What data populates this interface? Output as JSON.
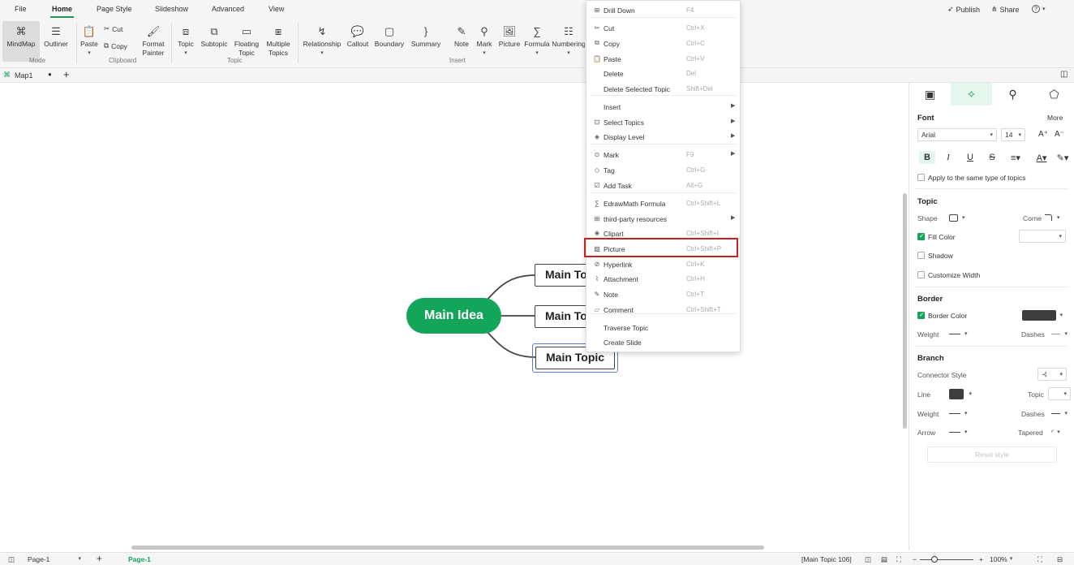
{
  "menubar": {
    "tabs": [
      "File",
      "Home",
      "Page Style",
      "Slideshow",
      "Advanced",
      "View"
    ],
    "active": "Home",
    "publish": "Publish",
    "share": "Share",
    "help": "?"
  },
  "ribbon": {
    "mode": {
      "mindmap": "MindMap",
      "outliner": "Outliner",
      "label": "Mode"
    },
    "clipboard": {
      "paste": "Paste",
      "cut": "Cut",
      "copy": "Copy",
      "format_painter_1": "Format",
      "format_painter_2": "Painter",
      "label": "Clipboard"
    },
    "topic": {
      "topic": "Topic",
      "subtopic": "Subtopic",
      "floating_1": "Floating",
      "floating_2": "Topic",
      "multiple_1": "Multiple",
      "multiple_2": "Topics",
      "label": "Topic"
    },
    "insert": {
      "relationship": "Relationship",
      "callout": "Callout",
      "boundary": "Boundary",
      "summary": "Summary",
      "note": "Note",
      "mark": "Mark",
      "picture": "Picture",
      "formula": "Formula",
      "numbering": "Numbering",
      "label": "Insert"
    }
  },
  "doctabs": {
    "file": "Map1"
  },
  "canvas": {
    "main_idea": "Main Idea",
    "topics": [
      "Main Topic",
      "Main Topic",
      "Main Topic"
    ]
  },
  "context_menu": {
    "items": [
      {
        "label": "Drill Down",
        "shortcut": "F4",
        "icon": "drill-down-icon"
      },
      {
        "label": "Cut",
        "shortcut": "Ctrl+X",
        "icon": "cut-icon"
      },
      {
        "label": "Copy",
        "shortcut": "Ctrl+C",
        "icon": "copy-icon"
      },
      {
        "label": "Paste",
        "shortcut": "Ctrl+V",
        "icon": "paste-icon"
      },
      {
        "label": "Delete",
        "shortcut": "Del"
      },
      {
        "label": "Delete Selected Topic",
        "shortcut": "Shift+Del"
      },
      {
        "label": "Insert",
        "shortcut": ""
      },
      {
        "label": "Select Topics",
        "shortcut": "",
        "icon": "select-icon"
      },
      {
        "label": "Display Level",
        "shortcut": "",
        "icon": "layers-icon"
      },
      {
        "label": "Mark",
        "shortcut": "F9",
        "icon": "mark-icon"
      },
      {
        "label": "Tag",
        "shortcut": "Ctrl+G",
        "icon": "tag-icon"
      },
      {
        "label": "Add Task",
        "shortcut": "Alt+G",
        "icon": "task-icon"
      },
      {
        "label": "EdrawMath Formula",
        "shortcut": "Ctrl+Shift+L",
        "icon": "formula-icon"
      },
      {
        "label": "third-party resources",
        "shortcut": "",
        "icon": "grid-icon"
      },
      {
        "label": "Clipart",
        "shortcut": "Ctrl+Shift+I",
        "icon": "clipart-icon"
      },
      {
        "label": "Picture",
        "shortcut": "Ctrl+Shift+P",
        "icon": "picture-icon"
      },
      {
        "label": "Hyperlink",
        "shortcut": "Ctrl+K",
        "icon": "link-icon"
      },
      {
        "label": "Attachment",
        "shortcut": "Ctrl+H",
        "icon": "attachment-icon"
      },
      {
        "label": "Note",
        "shortcut": "Ctrl+T",
        "icon": "note-icon"
      },
      {
        "label": "Comment",
        "shortcut": "Ctrl+Shift+T",
        "icon": "comment-icon"
      },
      {
        "label": "Traverse Topic",
        "shortcut": ""
      },
      {
        "label": "Create Slide",
        "shortcut": ""
      }
    ]
  },
  "panel": {
    "font": {
      "title": "Font",
      "more": "More",
      "family": "Arial",
      "size": "14",
      "apply_same": "Apply to the same type of topics"
    },
    "topic": {
      "title": "Topic",
      "shape": "Shape",
      "corner": "Corner",
      "fill_color": "Fill Color",
      "shadow": "Shadow",
      "customize_width": "Customize Width"
    },
    "border": {
      "title": "Border",
      "border_color": "Border Color",
      "weight": "Weight",
      "dashes": "Dashes",
      "color": "#3d3d3d"
    },
    "branch": {
      "title": "Branch",
      "connector_style": "Connector Style",
      "line": "Line",
      "topic": "Topic",
      "weight": "Weight",
      "dashes": "Dashes",
      "arrow": "Arrow",
      "tapered": "Tapered",
      "reset": "Reset style"
    }
  },
  "status": {
    "page_selector": "Page-1",
    "active_page": "Page-1",
    "selection": "[Main Topic 106]",
    "zoom": "100%"
  },
  "colors": {
    "brand": "#13a659",
    "highlight": "#cc1f1f"
  }
}
